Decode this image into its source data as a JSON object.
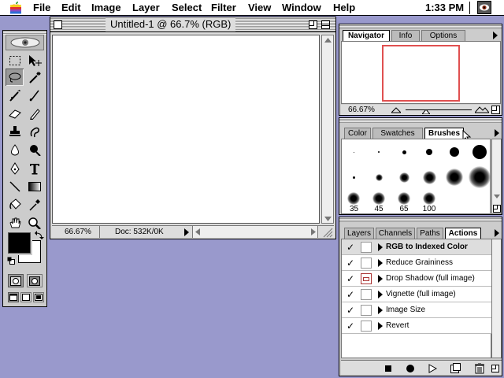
{
  "menubar": {
    "items": [
      "File",
      "Edit",
      "Image",
      "Layer",
      "Select",
      "Filter",
      "View",
      "Window",
      "Help"
    ],
    "clock": "1:33 PM"
  },
  "document": {
    "title": "Untitled-1 @ 66.7% (RGB)",
    "zoom": "66.67%",
    "doc_size": "Doc: 532K/0K"
  },
  "navigator": {
    "tabs": [
      "Navigator",
      "Info",
      "Options"
    ],
    "active_tab": "Navigator",
    "zoom": "66.67%"
  },
  "brushes": {
    "tabs": [
      "Color",
      "Swatches",
      "Brushes"
    ],
    "active_tab": "Brushes",
    "size_labels": [
      "35",
      "45",
      "65",
      "100"
    ]
  },
  "actions": {
    "tabs": [
      "Layers",
      "Channels",
      "Paths",
      "Actions"
    ],
    "active_tab": "Actions",
    "items": [
      {
        "label": "RGB to Indexed Color",
        "checked": true,
        "dialog": false,
        "selected": true
      },
      {
        "label": "Reduce Graininess",
        "checked": true,
        "dialog": false,
        "selected": false
      },
      {
        "label": "Drop Shadow (full image)",
        "checked": true,
        "dialog": true,
        "selected": false
      },
      {
        "label": "Vignette (full image)",
        "checked": true,
        "dialog": false,
        "selected": false
      },
      {
        "label": "Image Size",
        "checked": true,
        "dialog": false,
        "selected": false
      },
      {
        "label": "Revert",
        "checked": true,
        "dialog": false,
        "selected": false
      }
    ]
  },
  "colors": {
    "desktop": "#9999cc",
    "foreground": "#000000",
    "background": "#ffffff",
    "navigator_view_box": "#e05050"
  }
}
